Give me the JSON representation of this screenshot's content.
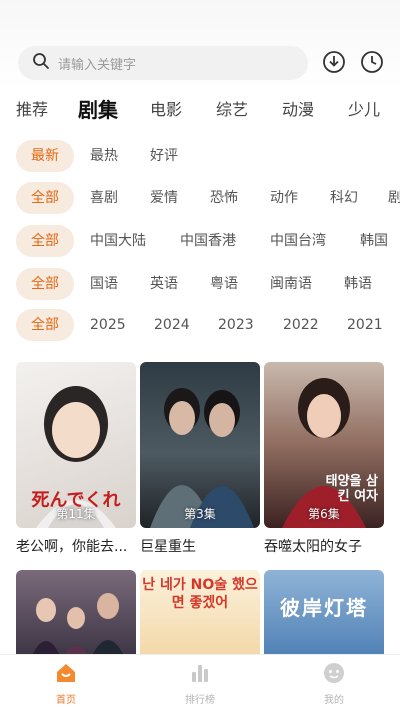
{
  "search": {
    "placeholder": "请输入关键字"
  },
  "categories": [
    "推荐",
    "剧集",
    "电影",
    "综艺",
    "动漫",
    "少儿"
  ],
  "filters": {
    "sort": [
      "最新",
      "最热",
      "好评"
    ],
    "genre": [
      "全部",
      "喜剧",
      "爱情",
      "恐怖",
      "动作",
      "科幻",
      "剧"
    ],
    "region": [
      "全部",
      "中国大陆",
      "中国香港",
      "中国台湾",
      "韩国"
    ],
    "language": [
      "全部",
      "国语",
      "英语",
      "粤语",
      "闽南语",
      "韩语"
    ],
    "year": [
      "全部",
      "2025",
      "2024",
      "2023",
      "2022",
      "2021"
    ]
  },
  "posters": [
    {
      "title": "老公啊，你能去...",
      "episode": "第11集",
      "overlay": "死んでくれ"
    },
    {
      "title": "巨星重生",
      "episode": "第3集",
      "overlay": ""
    },
    {
      "title": "吞噬太阳的女子",
      "episode": "第6集",
      "overlay": "태양을 삼킨 여자"
    }
  ],
  "second_row": [
    {
      "overlay": ""
    },
    {
      "overlay": "난 네가 NO술 했으면 좋겠어"
    },
    {
      "overlay": "彼岸灯塔"
    }
  ],
  "tabs": [
    {
      "label": "首页",
      "active": true
    },
    {
      "label": "排行榜",
      "active": false
    },
    {
      "label": "我的",
      "active": false
    }
  ],
  "colors": {
    "accent": "#ef7a2a",
    "chip_bg": "#f7eadf"
  }
}
